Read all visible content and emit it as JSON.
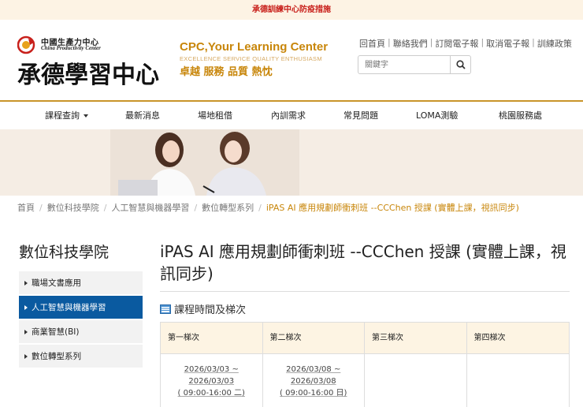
{
  "announcement": "承德訓練中心防疫措施",
  "logo": {
    "org_cn": "中國生產力中心",
    "org_en": "China Productivity Center",
    "main": "承德學習中心"
  },
  "slogan": {
    "title": "CPC,Your Learning Center",
    "subtitle": "EXCELLENCE SERVICE QUALITY  ENTHUSIASM",
    "cn": "卓越 服務 品質 熱忱"
  },
  "top_links": [
    "回首頁",
    "聯絡我們",
    "訂閱電子報",
    "取消電子報",
    "訓練政策"
  ],
  "search": {
    "placeholder": "關鍵字"
  },
  "nav": [
    "課程查詢",
    "最新消息",
    "場地租借",
    "內訓需求",
    "常見問題",
    "LOMA測驗",
    "桃園服務處"
  ],
  "breadcrumb": [
    "首頁",
    "數位科技學院",
    "人工智慧與機器學習",
    "數位轉型系列",
    "iPAS AI 應用規劃師衝刺班 --CCChen 授課 (實體上課，視訊同步)"
  ],
  "sidebar": {
    "title": "數位科技學院",
    "items": [
      "職場文書應用",
      "人工智慧與機器學習",
      "商業智慧(BI)",
      "數位轉型系列"
    ],
    "active_index": 1
  },
  "course": {
    "title": "iPAS AI 應用規劃師衝刺班 --CCChen 授課 (實體上課，視訊同步)",
    "section": "課程時間及梯次"
  },
  "schedule": {
    "headers": [
      "第一梯次",
      "第二梯次",
      "第三梯次",
      "第四梯次"
    ],
    "rows": [
      [
        "2026/03/03 ~",
        "2026/03/03",
        "( 09:00-16:00 二)"
      ],
      [
        "2026/03/08 ~",
        "2026/03/08",
        "( 09:00-16:00 日)"
      ]
    ]
  },
  "colors": {
    "accent_gold": "#c9952a",
    "slogan": "#c8860a",
    "active_blue": "#0a5aa0",
    "announcement": "#c8201b"
  }
}
